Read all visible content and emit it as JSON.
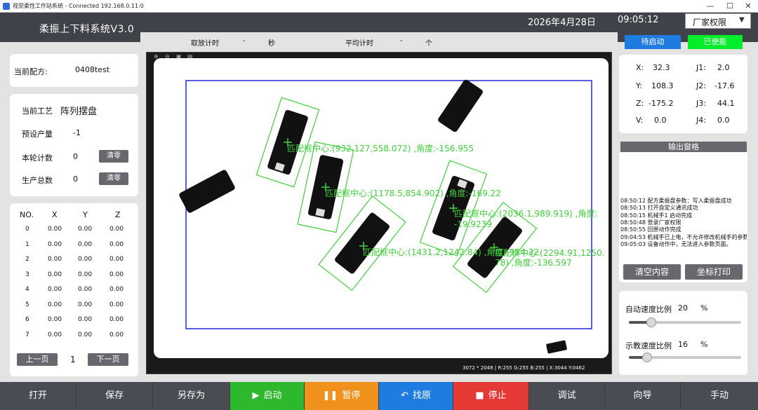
{
  "window": {
    "title": "视觉柔性工作站系统 - Connected 192.168.0.11:0",
    "min": "—",
    "max": "☐",
    "close": "✕"
  },
  "header": {
    "app_title": "柔振上下料系统V3.0",
    "date": "2026年4月28日",
    "time": "09:05:12",
    "role": "厂家权限"
  },
  "timer": {
    "pick_label": "取放计时",
    "pick_value": "-",
    "pick_unit": "秒",
    "avg_label": "平均计时",
    "avg_value": "-",
    "avg_unit": "个"
  },
  "status": {
    "waiting": "待启动",
    "enabled": "已使能"
  },
  "recipe": {
    "label": "当前配方:",
    "value": "0408test"
  },
  "process": {
    "label": "当前工艺",
    "value": "阵列摆盘",
    "preset_label": "预设产量",
    "preset_value": "-1",
    "round_label": "本轮计数",
    "round_value": "0",
    "total_label": "生产总数",
    "total_value": "0",
    "clear_label": "清零"
  },
  "points_table": {
    "headers": [
      "NO.",
      "X",
      "Y",
      "Z"
    ],
    "rows": [
      [
        "0",
        "0.00",
        "0.00",
        "0.00"
      ],
      [
        "1",
        "0.00",
        "0.00",
        "0.00"
      ],
      [
        "2",
        "0.00",
        "0.00",
        "0.00"
      ],
      [
        "3",
        "0.00",
        "0.00",
        "0.00"
      ],
      [
        "4",
        "0.00",
        "0.00",
        "0.00"
      ],
      [
        "5",
        "0.00",
        "0.00",
        "0.00"
      ],
      [
        "6",
        "0.00",
        "0.00",
        "0.00"
      ],
      [
        "7",
        "0.00",
        "0.00",
        "0.00"
      ]
    ],
    "prev_label": "上一页",
    "page": "1",
    "next_label": "下一页"
  },
  "camera": {
    "status": "3072 * 2048 | R:255 G:255 B:255 | X:3044 Y:0462",
    "detections": [
      {
        "label": "匹配框中心:(932.127,558.072) ,角度:-156.955"
      },
      {
        "label": "匹配框中心:(1178.5,854.902) ,角度:-169.22"
      },
      {
        "label": "匹配框中心:(2036.1,989.919) ,角度:"
      },
      {
        "label": "-19.9239"
      },
      {
        "label": "匹配框中心:(1431.2,1242.84) ,角度:-154.32"
      },
      {
        "label": "匹配框中心:(2294.91,1250."
      },
      {
        "label": "78) ,角度:-136.597"
      }
    ],
    "colors": {
      "roi": "#1f2bd6",
      "match": "#3fd13a"
    }
  },
  "coords": {
    "x_label": "X:",
    "x": "32.3",
    "y_label": "Y:",
    "y": "108.3",
    "z_label": "Z:",
    "z": "-175.2",
    "v_label": "V:",
    "v": "0.0",
    "j1_label": "J1:",
    "j1": "2.0",
    "j2_label": "J2:",
    "j2": "-17.6",
    "j3_label": "J3:",
    "j3": "44.1",
    "j4_label": "J4:",
    "j4": "0.0"
  },
  "output": {
    "title": "输出窗格",
    "logs": [
      "08:50:12  配方柔振盘参数：写入柔振盘成功",
      "08:50:13  打开自定义通讯成功",
      "08:50:15  机械手1 启动完成",
      "08:50:48  登录厂家权限",
      "08:50:55  回原动作完成",
      "09:04:53  机械手已上电，不允许修改机械手的参数",
      "09:05:03  设备动作中，无法进入参数页面。"
    ],
    "clear_label": "清空内容",
    "print_label": "坐标打印"
  },
  "speed": {
    "auto_label": "自动速度比例",
    "auto_value": "20",
    "auto_unit": "%",
    "auto_fraction": 0.2,
    "teach_label": "示教速度比例",
    "teach_value": "16",
    "teach_unit": "%",
    "teach_fraction": 0.16
  },
  "bottom": {
    "open": "打开",
    "save": "保存",
    "saveas": "另存为",
    "start": "启动",
    "pause": "暂停",
    "home": "找原",
    "stop": "停止",
    "debug": "调试",
    "wizard": "向导",
    "manual": "手动",
    "colors": {
      "start": "#2eb82e",
      "pause": "#f0911b",
      "home": "#1e7be0",
      "stop": "#e53935"
    }
  }
}
